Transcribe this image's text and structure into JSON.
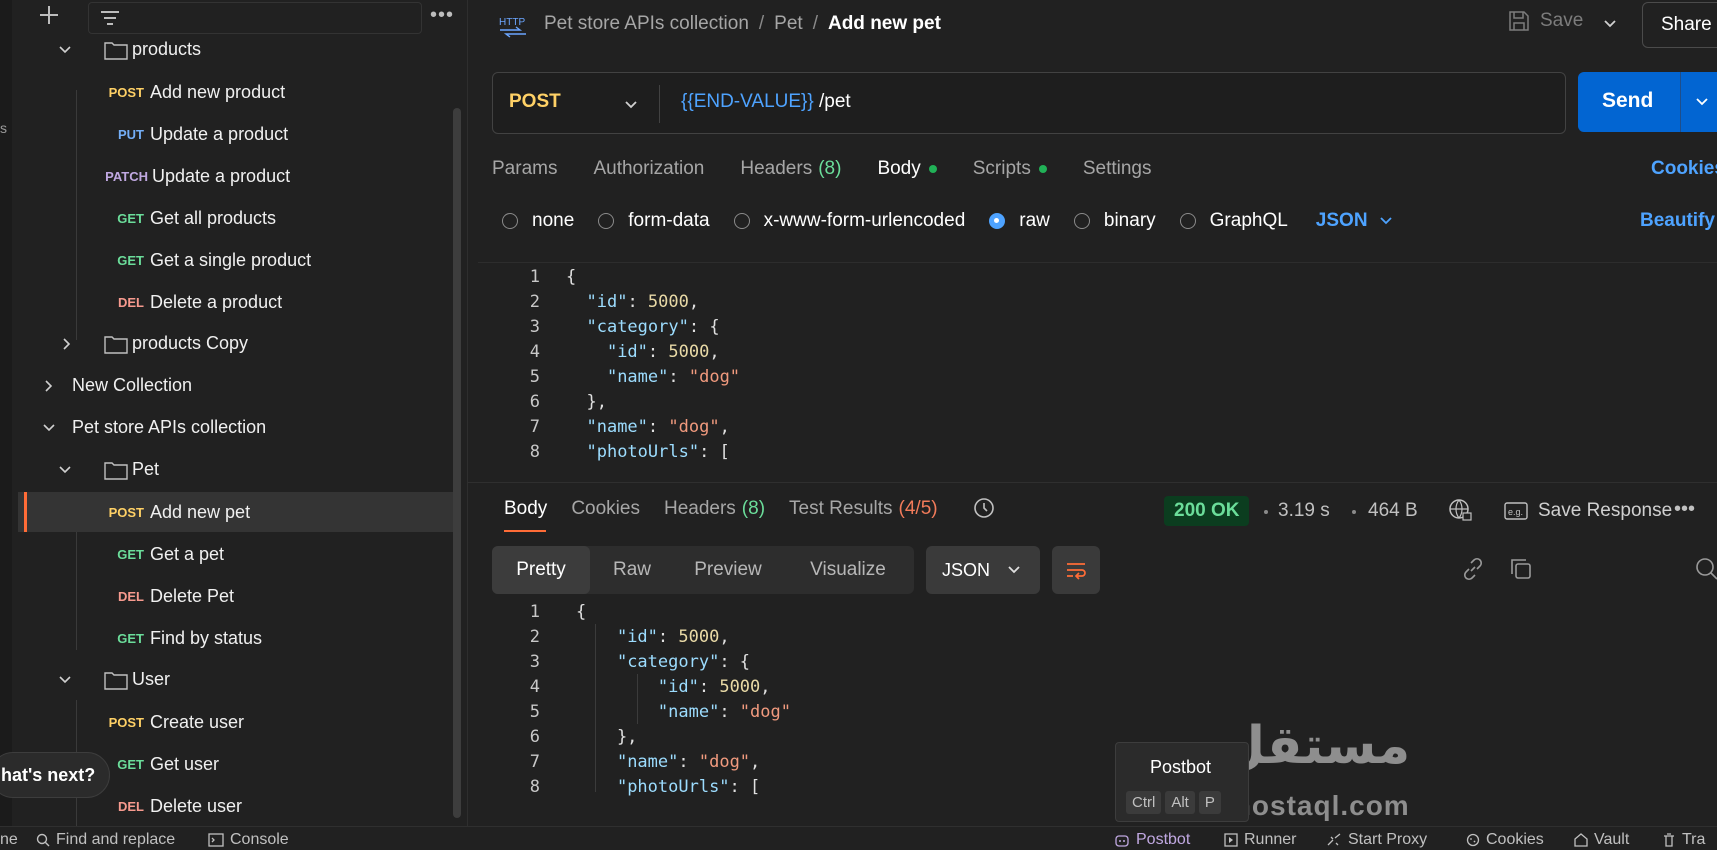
{
  "sidebar": {
    "tree": [
      {
        "type": "folder",
        "label": "products"
      },
      {
        "type": "request",
        "method": "POST",
        "label": "Add new product"
      },
      {
        "type": "request",
        "method": "PUT",
        "label": "Update a product"
      },
      {
        "type": "request",
        "method": "PATCH",
        "label": "Update a product"
      },
      {
        "type": "request",
        "method": "GET",
        "label": "Get all products"
      },
      {
        "type": "request",
        "method": "GET",
        "label": "Get a single product"
      },
      {
        "type": "request",
        "method": "DEL",
        "label": "Delete a product"
      },
      {
        "type": "folder",
        "label": "products Copy"
      },
      {
        "type": "collection",
        "label": "New Collection"
      },
      {
        "type": "collection",
        "label": "Pet store APIs collection"
      },
      {
        "type": "folder",
        "label": "Pet"
      },
      {
        "type": "request",
        "method": "POST",
        "label": "Add new pet",
        "selected": true
      },
      {
        "type": "request",
        "method": "GET",
        "label": "Get a pet"
      },
      {
        "type": "request",
        "method": "DEL",
        "label": "Delete Pet"
      },
      {
        "type": "request",
        "method": "GET",
        "label": "Find by status"
      },
      {
        "type": "folder",
        "label": "User"
      },
      {
        "type": "request",
        "method": "POST",
        "label": "Create user"
      },
      {
        "type": "request",
        "method": "GET",
        "label": "Get user"
      },
      {
        "type": "request",
        "method": "DEL",
        "label": "Delete user"
      }
    ],
    "whats_next": "hat's next?",
    "left_clip": "s"
  },
  "header": {
    "breadcrumbs": [
      "Pet store APIs collection",
      "Pet",
      "Add new pet"
    ],
    "save_label": "Save",
    "share_label": "Share"
  },
  "request": {
    "method": "POST",
    "url_variable": "{{END-VALUE}}",
    "url_path": " /pet",
    "send_label": "Send",
    "tabs": {
      "params": "Params",
      "authorization": "Authorization",
      "headers": "Headers",
      "headers_count": "(8)",
      "body": "Body",
      "scripts": "Scripts",
      "settings": "Settings"
    },
    "cookies_label": "Cookies",
    "body_options": [
      "none",
      "form-data",
      "x-www-form-urlencoded",
      "raw",
      "binary",
      "GraphQL"
    ],
    "body_selected": "raw",
    "body_format": "JSON",
    "beautify_label": "Beautify",
    "body_lines": [
      "{",
      "  \"id\": 5000,",
      "  \"category\": {",
      "    \"id\": 5000,",
      "    \"name\": \"dog\"",
      "  },",
      "  \"name\": \"dog\",",
      "  \"photoUrls\": ["
    ]
  },
  "response": {
    "tabs": {
      "body": "Body",
      "cookies": "Cookies",
      "headers": "Headers",
      "headers_count": "(8)",
      "test_results": "Test Results",
      "test_count": "(4/5)"
    },
    "status": "200 OK",
    "time": "3.19 s",
    "size": "464 B",
    "save_response": "Save Response",
    "views": [
      "Pretty",
      "Raw",
      "Preview",
      "Visualize"
    ],
    "active_view": "Pretty",
    "format": "JSON",
    "lines": [
      "{",
      "    \"id\": 5000,",
      "    \"category\": {",
      "        \"id\": 5000,",
      "        \"name\": \"dog\"",
      "    },",
      "    \"name\": \"dog\",",
      "    \"photoUrls\": ["
    ]
  },
  "postbot_tooltip": {
    "title": "Postbot",
    "keys": [
      "Ctrl",
      "Alt",
      "P"
    ]
  },
  "watermark": {
    "arabic": "مستقل",
    "latin": "mostaql.com"
  },
  "footer": {
    "left": [
      "ne",
      "Find and replace",
      "Console"
    ],
    "right": [
      "Postbot",
      "Runner",
      "Start Proxy",
      "Cookies",
      "Vault",
      "Tra"
    ]
  },
  "colors": {
    "accent_orange": "#ff6c37",
    "send_blue": "#0265d2",
    "link_blue": "#4ea3ff",
    "post": "#ffd166",
    "get": "#6bdd9a",
    "put": "#74aef6",
    "patch": "#c0a8e1",
    "del": "#f79a8e"
  }
}
